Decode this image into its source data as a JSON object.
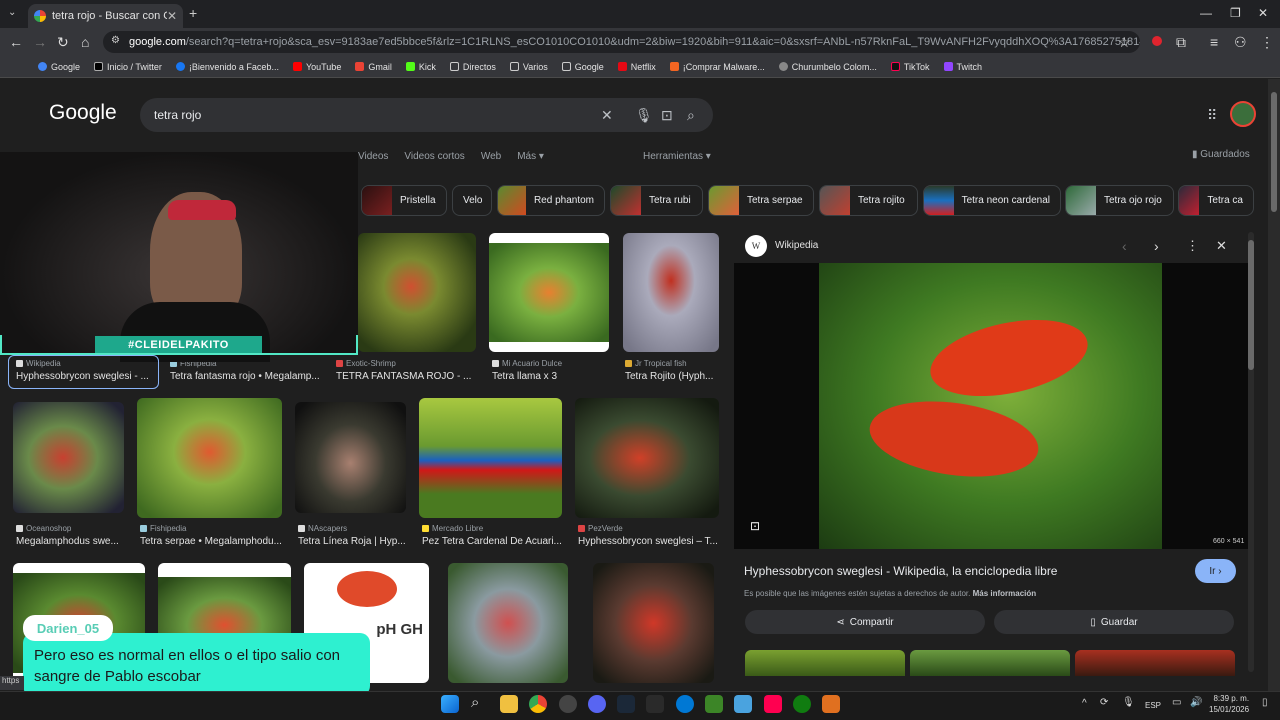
{
  "browser": {
    "tab_title": "tetra rojo - Buscar con Google",
    "url_host": "google.com",
    "url_path": "/search?q=tetra+rojo&sca_esv=9183ae7ed5bbce5f&rlz=1C1RLNS_esCO1010CO1010&udm=2&biw=1920&bih=911&aic=0&sxsrf=ANbL-n57RknFaL_T9WvANFH2FvyqddhXOQ%3A1768527518143&ei=npZpacm6CLOOwbkPy...",
    "bookmarks": [
      "Google",
      "Inicio / Twitter",
      "¡Bienvenido a Faceb...",
      "YouTube",
      "Gmail",
      "Kick",
      "Directos",
      "Varios",
      "Google",
      "Netflix",
      "¡Comprar Malware...",
      "Churumbelo Colom...",
      "TikTok",
      "Twitch"
    ],
    "status_url": "https"
  },
  "google": {
    "logo": "Google",
    "query": "tetra rojo",
    "filters": [
      "Videos",
      "Videos cortos",
      "Web",
      "Más ▾"
    ],
    "tools": "Herramientas ▾",
    "saved": "Guardados",
    "chips": [
      "Pristella",
      "Velo",
      "Red phantom",
      "Tetra rubi",
      "Tetra serpae",
      "Tetra rojito",
      "Tetra neon cardenal",
      "Tetra ojo rojo",
      "Tetra ca"
    ]
  },
  "results_row1": [
    {
      "source": "Wikipedia",
      "caption": "Hyphessobrycon sweglesi - ..."
    },
    {
      "source": "Fishipedia",
      "caption": "Tetra fantasma rojo • Megalamp..."
    },
    {
      "source": "Exotic-Shrimp",
      "caption": "TETRA FANTASMA ROJO - ..."
    },
    {
      "source": "Mi Acuario Dulce",
      "caption": "Tetra llama x 3"
    },
    {
      "source": "Jr Tropical fish",
      "caption": "Tetra Rojito (Hyph..."
    }
  ],
  "results_row2": [
    {
      "source": "Oceanoshop",
      "caption": "Megalamphodus swe..."
    },
    {
      "source": "Fishipedia",
      "caption": "Tetra serpae • Megalamphodu..."
    },
    {
      "source": "NAscapers",
      "caption": "Tetra Línea Roja | Hyp..."
    },
    {
      "source": "Mercado Libre",
      "caption": "Pez Tetra Cardenal De Acuari..."
    },
    {
      "source": "PezVerde",
      "caption": "Hyphessobrycon sweglesi – T..."
    }
  ],
  "row3_label": "pH  GH",
  "panel": {
    "source": "Wikipedia",
    "image_size": "660 × 541",
    "title": "Hyphessobrycon sweglesi - Wikipedia, la enciclopedia libre",
    "note": "Es posible que las imágenes estén sujetas a derechos de autor.",
    "note_link": "Más información",
    "go": "Ir ›",
    "share": "Compartir",
    "save": "Guardar"
  },
  "stream": {
    "cam_tag": "#CLEIDELPAKITO",
    "chat_user": "Darien_05",
    "chat_message": "Pero eso es normal en ellos o el tipo salio con sangre de Pablo escobar"
  },
  "taskbar": {
    "lang": "ESP",
    "time": "8:39 p. m.",
    "date": "15/01/2026"
  }
}
